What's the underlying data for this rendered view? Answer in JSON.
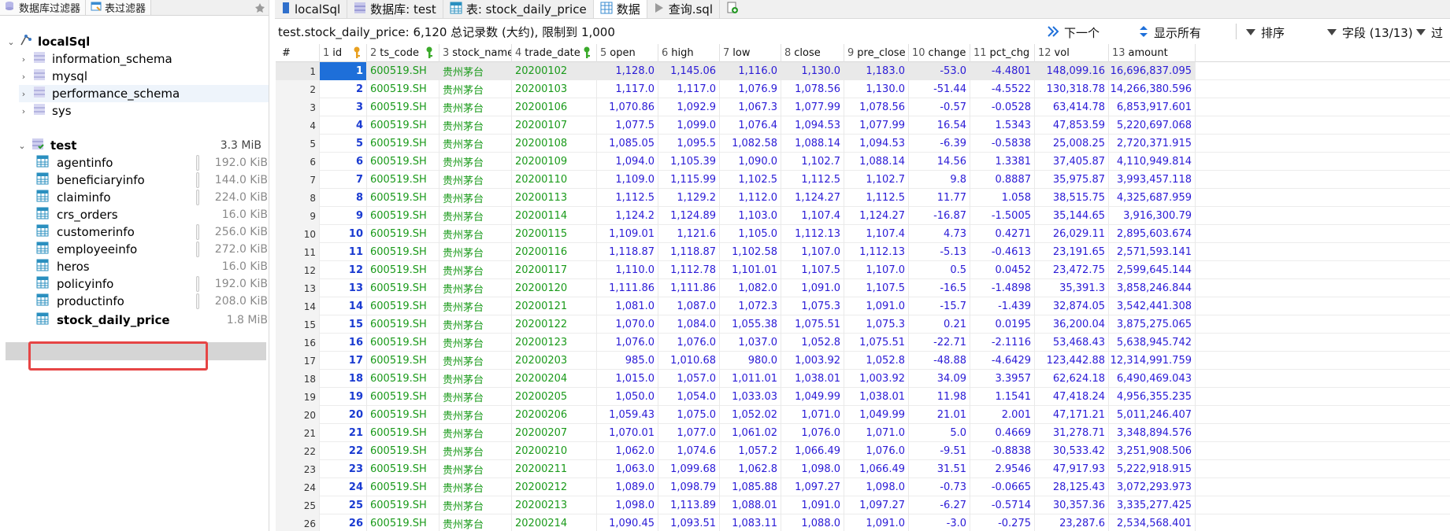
{
  "left_tabs": {
    "db_filter": "数据库过滤器",
    "table_filter": "表过滤器"
  },
  "tree": {
    "connection": "localSql",
    "databases": [
      {
        "name": "information_schema"
      },
      {
        "name": "mysql"
      },
      {
        "name": "performance_schema"
      },
      {
        "name": "sys"
      }
    ],
    "active_db": {
      "name": "test",
      "size": "3.3 MiB"
    },
    "tables": [
      {
        "name": "agentinfo",
        "size": "192.0 KiB",
        "bar": true
      },
      {
        "name": "beneficiaryinfo",
        "size": "144.0 KiB",
        "bar": true
      },
      {
        "name": "claiminfo",
        "size": "224.0 KiB",
        "bar": true
      },
      {
        "name": "crs_orders",
        "size": "16.0 KiB",
        "bar": false
      },
      {
        "name": "customerinfo",
        "size": "256.0 KiB",
        "bar": true
      },
      {
        "name": "employeeinfo",
        "size": "272.0 KiB",
        "bar": true
      },
      {
        "name": "heros",
        "size": "16.0 KiB",
        "bar": false
      },
      {
        "name": "policyinfo",
        "size": "192.0 KiB",
        "bar": true
      },
      {
        "name": "productinfo",
        "size": "208.0 KiB",
        "bar": true
      },
      {
        "name": "stock_daily_price",
        "size": "1.8 MiB",
        "bar": false
      }
    ]
  },
  "tabs": {
    "conn": "localSql",
    "db": "数据库: test",
    "table": "表: stock_daily_price",
    "data": "数据",
    "query": "查询.sql"
  },
  "toolbar": {
    "caption": "test.stock_daily_price: 6,120 总记录数 (大约), 限制到 1,000",
    "next": "下一个",
    "show_all": "显示所有",
    "sort": "排序",
    "fields": "字段 (13/13)",
    "filter": "过"
  },
  "columns": [
    {
      "num": "1",
      "name": "id",
      "key": "gold"
    },
    {
      "num": "2",
      "name": "ts_code",
      "key": "green"
    },
    {
      "num": "3",
      "name": "stock_name",
      "key": ""
    },
    {
      "num": "4",
      "name": "trade_date",
      "key": "green"
    },
    {
      "num": "5",
      "name": "open",
      "key": ""
    },
    {
      "num": "6",
      "name": "high",
      "key": ""
    },
    {
      "num": "7",
      "name": "low",
      "key": ""
    },
    {
      "num": "8",
      "name": "close",
      "key": ""
    },
    {
      "num": "9",
      "name": "pre_close",
      "key": ""
    },
    {
      "num": "10",
      "name": "change",
      "key": ""
    },
    {
      "num": "11",
      "name": "pct_chg",
      "key": ""
    },
    {
      "num": "12",
      "name": "vol",
      "key": ""
    },
    {
      "num": "13",
      "name": "amount",
      "key": ""
    }
  ],
  "rows": [
    [
      "1",
      "1",
      "600519.SH",
      "贵州茅台",
      "20200102",
      "1,128.0",
      "1,145.06",
      "1,116.0",
      "1,130.0",
      "1,183.0",
      "-53.0",
      "-4.4801",
      "148,099.16",
      "16,696,837.095"
    ],
    [
      "2",
      "2",
      "600519.SH",
      "贵州茅台",
      "20200103",
      "1,117.0",
      "1,117.0",
      "1,076.9",
      "1,078.56",
      "1,130.0",
      "-51.44",
      "-4.5522",
      "130,318.78",
      "14,266,380.596"
    ],
    [
      "3",
      "3",
      "600519.SH",
      "贵州茅台",
      "20200106",
      "1,070.86",
      "1,092.9",
      "1,067.3",
      "1,077.99",
      "1,078.56",
      "-0.57",
      "-0.0528",
      "63,414.78",
      "6,853,917.601"
    ],
    [
      "4",
      "4",
      "600519.SH",
      "贵州茅台",
      "20200107",
      "1,077.5",
      "1,099.0",
      "1,076.4",
      "1,094.53",
      "1,077.99",
      "16.54",
      "1.5343",
      "47,853.59",
      "5,220,697.068"
    ],
    [
      "5",
      "5",
      "600519.SH",
      "贵州茅台",
      "20200108",
      "1,085.05",
      "1,095.5",
      "1,082.58",
      "1,088.14",
      "1,094.53",
      "-6.39",
      "-0.5838",
      "25,008.25",
      "2,720,371.915"
    ],
    [
      "6",
      "6",
      "600519.SH",
      "贵州茅台",
      "20200109",
      "1,094.0",
      "1,105.39",
      "1,090.0",
      "1,102.7",
      "1,088.14",
      "14.56",
      "1.3381",
      "37,405.87",
      "4,110,949.814"
    ],
    [
      "7",
      "7",
      "600519.SH",
      "贵州茅台",
      "20200110",
      "1,109.0",
      "1,115.99",
      "1,102.5",
      "1,112.5",
      "1,102.7",
      "9.8",
      "0.8887",
      "35,975.87",
      "3,993,457.118"
    ],
    [
      "8",
      "8",
      "600519.SH",
      "贵州茅台",
      "20200113",
      "1,112.5",
      "1,129.2",
      "1,112.0",
      "1,124.27",
      "1,112.5",
      "11.77",
      "1.058",
      "38,515.75",
      "4,325,687.959"
    ],
    [
      "9",
      "9",
      "600519.SH",
      "贵州茅台",
      "20200114",
      "1,124.2",
      "1,124.89",
      "1,103.0",
      "1,107.4",
      "1,124.27",
      "-16.87",
      "-1.5005",
      "35,144.65",
      "3,916,300.79"
    ],
    [
      "10",
      "10",
      "600519.SH",
      "贵州茅台",
      "20200115",
      "1,109.01",
      "1,121.6",
      "1,105.0",
      "1,112.13",
      "1,107.4",
      "4.73",
      "0.4271",
      "26,029.11",
      "2,895,603.674"
    ],
    [
      "11",
      "11",
      "600519.SH",
      "贵州茅台",
      "20200116",
      "1,118.87",
      "1,118.87",
      "1,102.58",
      "1,107.0",
      "1,112.13",
      "-5.13",
      "-0.4613",
      "23,191.65",
      "2,571,593.141"
    ],
    [
      "12",
      "12",
      "600519.SH",
      "贵州茅台",
      "20200117",
      "1,110.0",
      "1,112.78",
      "1,101.01",
      "1,107.5",
      "1,107.0",
      "0.5",
      "0.0452",
      "23,472.75",
      "2,599,645.144"
    ],
    [
      "13",
      "13",
      "600519.SH",
      "贵州茅台",
      "20200120",
      "1,111.86",
      "1,111.86",
      "1,082.0",
      "1,091.0",
      "1,107.5",
      "-16.5",
      "-1.4898",
      "35,391.3",
      "3,858,246.844"
    ],
    [
      "14",
      "14",
      "600519.SH",
      "贵州茅台",
      "20200121",
      "1,081.0",
      "1,087.0",
      "1,072.3",
      "1,075.3",
      "1,091.0",
      "-15.7",
      "-1.439",
      "32,874.05",
      "3,542,441.308"
    ],
    [
      "15",
      "15",
      "600519.SH",
      "贵州茅台",
      "20200122",
      "1,070.0",
      "1,084.0",
      "1,055.38",
      "1,075.51",
      "1,075.3",
      "0.21",
      "0.0195",
      "36,200.04",
      "3,875,275.065"
    ],
    [
      "16",
      "16",
      "600519.SH",
      "贵州茅台",
      "20200123",
      "1,076.0",
      "1,076.0",
      "1,037.0",
      "1,052.8",
      "1,075.51",
      "-22.71",
      "-2.1116",
      "53,468.43",
      "5,638,945.742"
    ],
    [
      "17",
      "17",
      "600519.SH",
      "贵州茅台",
      "20200203",
      "985.0",
      "1,010.68",
      "980.0",
      "1,003.92",
      "1,052.8",
      "-48.88",
      "-4.6429",
      "123,442.88",
      "12,314,991.759"
    ],
    [
      "18",
      "18",
      "600519.SH",
      "贵州茅台",
      "20200204",
      "1,015.0",
      "1,057.0",
      "1,011.01",
      "1,038.01",
      "1,003.92",
      "34.09",
      "3.3957",
      "62,624.18",
      "6,490,469.043"
    ],
    [
      "19",
      "19",
      "600519.SH",
      "贵州茅台",
      "20200205",
      "1,050.0",
      "1,054.0",
      "1,033.03",
      "1,049.99",
      "1,038.01",
      "11.98",
      "1.1541",
      "47,418.24",
      "4,956,355.235"
    ],
    [
      "20",
      "20",
      "600519.SH",
      "贵州茅台",
      "20200206",
      "1,059.43",
      "1,075.0",
      "1,052.02",
      "1,071.0",
      "1,049.99",
      "21.01",
      "2.001",
      "47,171.21",
      "5,011,246.407"
    ],
    [
      "21",
      "21",
      "600519.SH",
      "贵州茅台",
      "20200207",
      "1,070.01",
      "1,077.0",
      "1,061.02",
      "1,076.0",
      "1,071.0",
      "5.0",
      "0.4669",
      "31,278.71",
      "3,348,894.576"
    ],
    [
      "22",
      "22",
      "600519.SH",
      "贵州茅台",
      "20200210",
      "1,062.0",
      "1,074.6",
      "1,057.2",
      "1,066.49",
      "1,076.0",
      "-9.51",
      "-0.8838",
      "30,533.42",
      "3,251,908.506"
    ],
    [
      "23",
      "23",
      "600519.SH",
      "贵州茅台",
      "20200211",
      "1,063.0",
      "1,099.68",
      "1,062.8",
      "1,098.0",
      "1,066.49",
      "31.51",
      "2.9546",
      "47,917.93",
      "5,222,918.915"
    ],
    [
      "24",
      "24",
      "600519.SH",
      "贵州茅台",
      "20200212",
      "1,089.0",
      "1,098.79",
      "1,085.88",
      "1,097.27",
      "1,098.0",
      "-0.73",
      "-0.0665",
      "28,125.43",
      "3,072,293.973"
    ],
    [
      "25",
      "25",
      "600519.SH",
      "贵州茅台",
      "20200213",
      "1,098.0",
      "1,113.89",
      "1,088.01",
      "1,091.0",
      "1,097.27",
      "-6.27",
      "-0.5714",
      "30,357.36",
      "3,335,277.425"
    ],
    [
      "26",
      "26",
      "600519.SH",
      "贵州茅台",
      "20200214",
      "1,090.45",
      "1,093.51",
      "1,083.11",
      "1,088.0",
      "1,091.0",
      "-3.0",
      "-0.275",
      "23,287.6",
      "2,534,568.401"
    ]
  ]
}
